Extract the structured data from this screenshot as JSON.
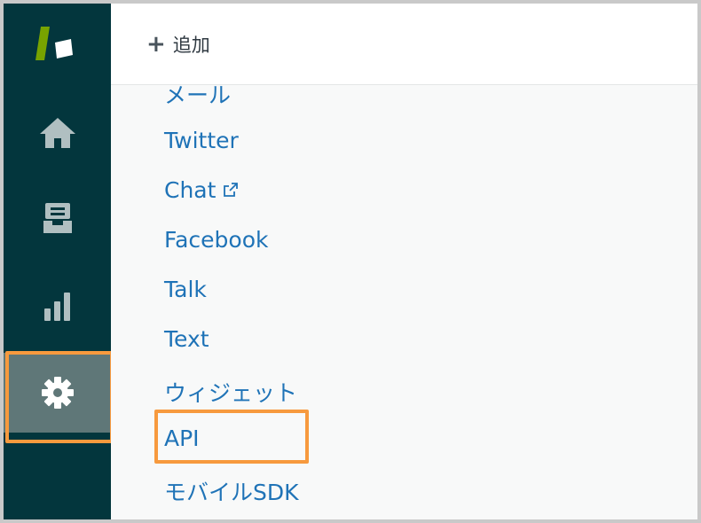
{
  "toolbar": {
    "add_label": "追加",
    "add_icon": "plus-icon"
  },
  "sidebar": {
    "items": [
      {
        "name": "home",
        "icon": "home-icon"
      },
      {
        "name": "views",
        "icon": "views-icon"
      },
      {
        "name": "reports",
        "icon": "bar-chart-icon"
      },
      {
        "name": "admin",
        "icon": "gear-icon",
        "selected": true
      }
    ]
  },
  "channels": {
    "items": [
      {
        "label": "メール"
      },
      {
        "label": "Twitter"
      },
      {
        "label": "Chat",
        "external": true
      },
      {
        "label": "Facebook"
      },
      {
        "label": "Talk"
      },
      {
        "label": "Text"
      },
      {
        "label": "ウィジェット"
      },
      {
        "label": "API",
        "highlighted": true
      },
      {
        "label": "モバイルSDK"
      }
    ]
  },
  "colors": {
    "sidebar_bg": "#03363d",
    "selected_bg": "#5f7778",
    "link": "#1f73b7",
    "highlight": "#f79a3e",
    "logo_green": "#78a300"
  }
}
